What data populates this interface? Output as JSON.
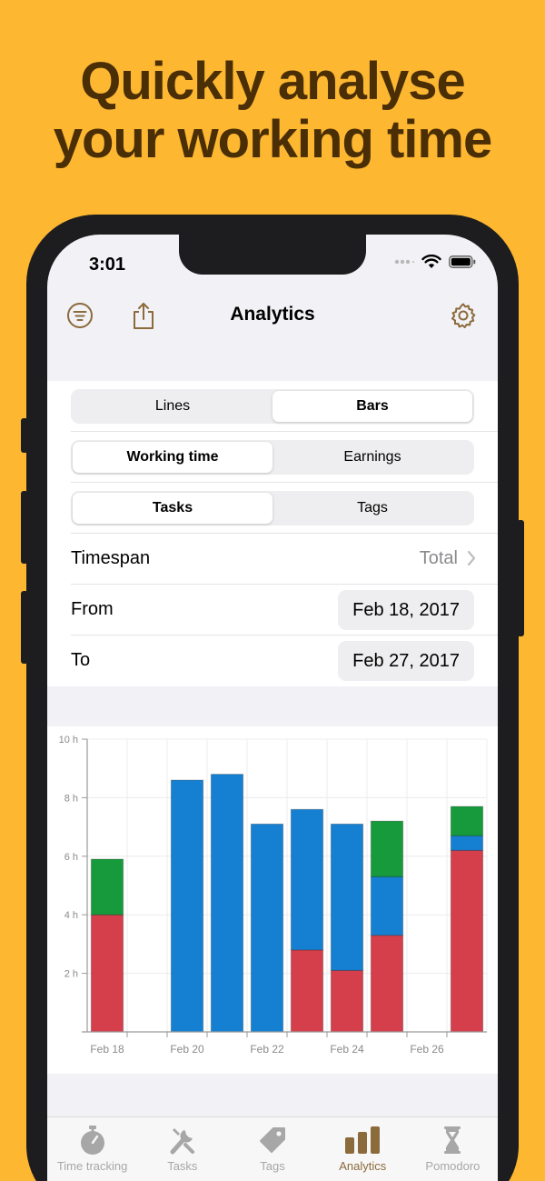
{
  "headline": {
    "line1": "Quickly analyse",
    "line2": "your working time"
  },
  "status": {
    "time": "3:01"
  },
  "nav": {
    "title": "Analytics",
    "left_icon": "filter-icon",
    "share_icon": "share-icon",
    "right_icon": "gear-icon"
  },
  "segments": [
    {
      "options": [
        "Lines",
        "Bars"
      ],
      "selected": 1
    },
    {
      "options": [
        "Working time",
        "Earnings"
      ],
      "selected": 0
    },
    {
      "options": [
        "Tasks",
        "Tags"
      ],
      "selected": 0
    }
  ],
  "timespan": {
    "label": "Timespan",
    "value": "Total"
  },
  "from": {
    "label": "From",
    "value": "Feb 18, 2017"
  },
  "to": {
    "label": "To",
    "value": "Feb 27, 2017"
  },
  "tabs": [
    {
      "label": "Time tracking",
      "icon": "stopwatch-icon"
    },
    {
      "label": "Tasks",
      "icon": "tools-icon"
    },
    {
      "label": "Tags",
      "icon": "tag-icon"
    },
    {
      "label": "Analytics",
      "icon": "bar-chart-icon",
      "active": true
    },
    {
      "label": "Pomodoro",
      "icon": "hourglass-icon"
    }
  ],
  "colors": {
    "accent": "#8B6A3C",
    "background": "#FDB731",
    "red": "#D43F4B",
    "blue": "#1580D2",
    "green": "#169A3C"
  },
  "chart_data": {
    "type": "bar",
    "stacked": true,
    "categories": [
      "Feb 18",
      "Feb 19",
      "Feb 20",
      "Feb 21",
      "Feb 22",
      "Feb 23",
      "Feb 24",
      "Feb 25",
      "Feb 26",
      "Feb 27"
    ],
    "tick_labels": [
      "Feb 18",
      "Feb 20",
      "Feb 22",
      "Feb 24",
      "Feb 26"
    ],
    "y_tick_labels": [
      "2 h",
      "4 h",
      "6 h",
      "8 h",
      "10 h"
    ],
    "ylim": [
      0,
      10
    ],
    "series": [
      {
        "color": "#D43F4B",
        "values": [
          4.0,
          0,
          0,
          0,
          0,
          2.8,
          2.1,
          3.3,
          0,
          6.2
        ]
      },
      {
        "color": "#1580D2",
        "values": [
          0,
          0,
          8.6,
          8.8,
          7.1,
          4.8,
          5.0,
          2.0,
          0,
          0.5
        ]
      },
      {
        "color": "#169A3C",
        "values": [
          1.9,
          0,
          0,
          0,
          0,
          0,
          0,
          1.9,
          0,
          1.0
        ]
      }
    ],
    "grid": true
  }
}
